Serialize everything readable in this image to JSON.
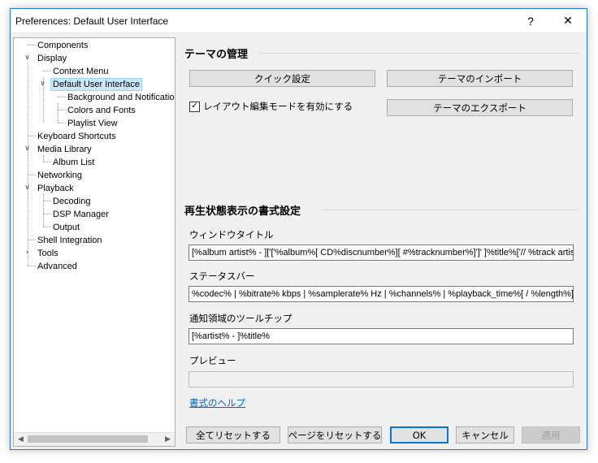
{
  "window": {
    "title": "Preferences: Default User Interface",
    "help_glyph": "?",
    "close_glyph": "✕"
  },
  "tree": {
    "items": [
      {
        "label": "Components"
      },
      {
        "label": "Display"
      },
      {
        "label": "Context Menu"
      },
      {
        "label": "Default User Interface"
      },
      {
        "label": "Background and Notification"
      },
      {
        "label": "Colors and Fonts"
      },
      {
        "label": "Playlist View"
      },
      {
        "label": "Keyboard Shortcuts"
      },
      {
        "label": "Media Library"
      },
      {
        "label": "Album List"
      },
      {
        "label": "Networking"
      },
      {
        "label": "Playback"
      },
      {
        "label": "Decoding"
      },
      {
        "label": "DSP Manager"
      },
      {
        "label": "Output"
      },
      {
        "label": "Shell Integration"
      },
      {
        "label": "Tools"
      },
      {
        "label": "Advanced"
      }
    ],
    "expander_open": "∨",
    "expander_closed": "›",
    "scroll_left": "◀",
    "scroll_right": "▶"
  },
  "theme": {
    "heading": "テーマの管理",
    "quick_setup": "クイック設定",
    "import": "テーマのインポート",
    "export": "テーマのエクスポート",
    "layout_edit_label": "レイアウト編集モードを有効にする",
    "layout_edit_checked": "✓"
  },
  "format": {
    "heading": "再生状態表示の書式設定",
    "window_title_label": "ウィンドウタイトル",
    "window_title_value": "[%album artist% - ]['['%album%[ CD%discnumber%][ #%tracknumber%]']' ]%title%['// %track artist%]",
    "status_bar_label": "ステータスバー",
    "status_bar_value": "%codec% | %bitrate% kbps | %samplerate% Hz | %channels% | %playback_time%[ / %length%]",
    "tooltip_label": "通知領域のツールチップ",
    "tooltip_value": "[%artist% - ]%title%",
    "preview_label": "プレビュー",
    "preview_value": "",
    "help_link": "書式のヘルプ"
  },
  "footer": {
    "reset_all": "全てリセットする",
    "reset_page": "ページをリセットする",
    "ok": "OK",
    "cancel": "キャンセル",
    "apply": "適用"
  }
}
